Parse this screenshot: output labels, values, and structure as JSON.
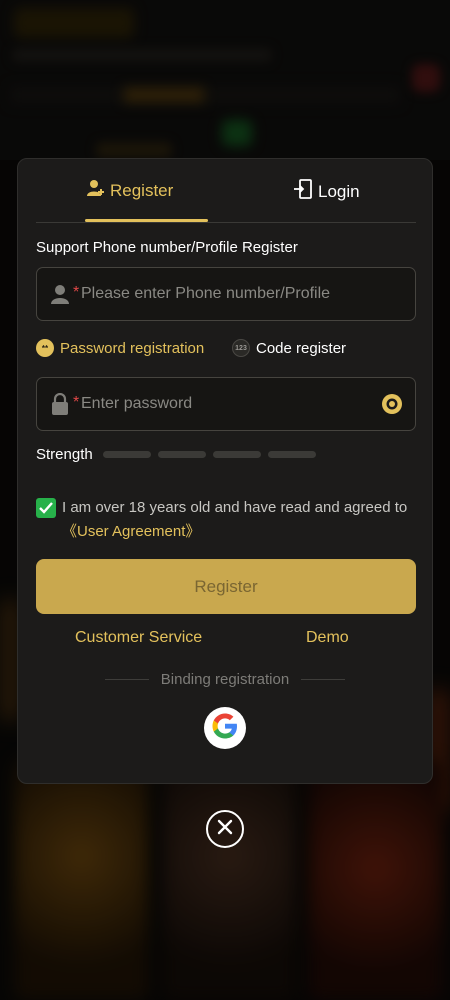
{
  "tabs": {
    "register_label": "Register",
    "login_label": "Login"
  },
  "form": {
    "section_label": "Support Phone number/Profile Register",
    "phone_required_mark": "*",
    "phone_placeholder": "Please enter Phone number/Profile",
    "options": {
      "password_label": "Password registration",
      "password_icon_text": "**",
      "code_label": "Code register",
      "code_icon_text": "123"
    },
    "password_required_mark": "*",
    "password_placeholder": "Enter password",
    "strength_label": "Strength",
    "strength_level": 0,
    "agreement_text": "I am over 18 years old and have read and agreed to ",
    "agreement_link": "《User Agreement》",
    "agreement_checked": true,
    "register_button": "Register"
  },
  "links": {
    "customer_service": "Customer Service",
    "demo": "Demo"
  },
  "binding_label": "Binding registration",
  "icons": {
    "register_tab": "user-add-icon",
    "login_tab": "login-door-icon",
    "phone": "user-icon",
    "password": "lock-icon",
    "visibility": "eye-icon",
    "google": "google-icon",
    "close": "close-icon"
  },
  "colors": {
    "accent": "#e3c15c",
    "button": "#c9a84e",
    "check": "#27b14a",
    "modal_bg": "#1c1b1a"
  }
}
